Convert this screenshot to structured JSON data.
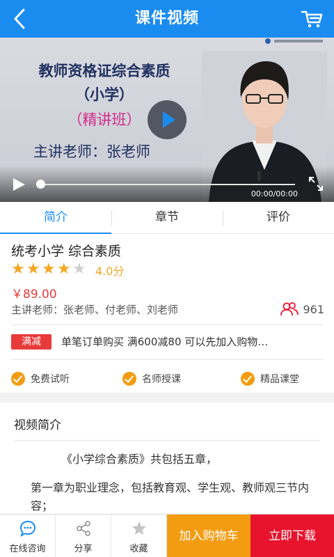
{
  "header": {
    "title": "课件视频"
  },
  "video": {
    "line1": "教师资格证综合素质",
    "line2": "（小学）",
    "line3": "（精讲班）",
    "line4": "主讲老师：张老师",
    "time": "00:00/00:00",
    "progress": 0.0
  },
  "tabs": [
    {
      "label": "简介",
      "active": true
    },
    {
      "label": "章节",
      "active": false
    },
    {
      "label": "评价",
      "active": false
    }
  ],
  "course": {
    "title": "统考小学 综合素质",
    "rating_stars": 4,
    "rating_max": 5,
    "rating_text": "4.0分",
    "price": "￥89.00",
    "teachers": "主讲老师：张老师、付老师、刘老师",
    "fans": "961",
    "promo_badge": "满减",
    "promo_text": "单笔订单购买 满600减80 可以先加入购物…",
    "features": [
      "免费试听",
      "名师授课",
      "精品课堂"
    ]
  },
  "description": {
    "title": "视频简介",
    "para1": "《小学综合素质》共包括五章，",
    "para2": "第一章为职业理念，包括教育观、学生观、教师观三节内容；"
  },
  "bottom": {
    "consult": "在线咨询",
    "share": "分享",
    "favorite": "收藏",
    "add_cart": "加入购物车",
    "buy_now": "立即下载"
  },
  "colors": {
    "primary": "#1a8cf0",
    "accent_orange": "#f39c12",
    "accent_red": "#e8142d",
    "star": "#f5a623"
  }
}
